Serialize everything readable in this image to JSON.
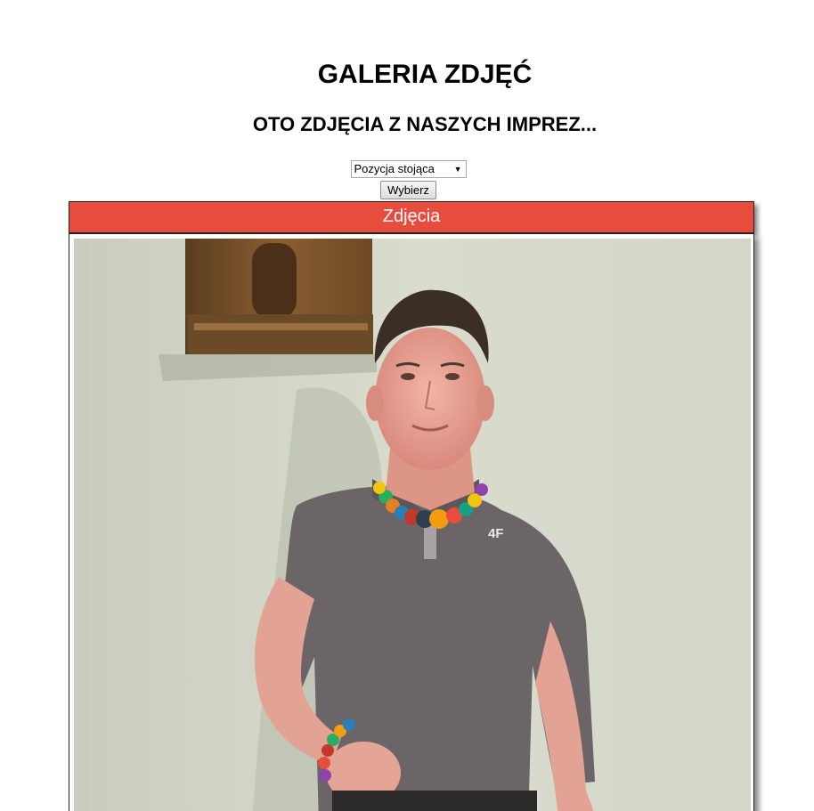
{
  "page": {
    "title": "GALERIA ZDJĘĆ",
    "subtitle": "OTO ZDJĘCIA Z NASZYCH IMPREZ..."
  },
  "form": {
    "select_value": "Pozycja stojąca",
    "button_label": "Wybierz"
  },
  "gallery": {
    "header": "Zdjęcia"
  },
  "photo": {
    "shirt_logo": "4F"
  }
}
